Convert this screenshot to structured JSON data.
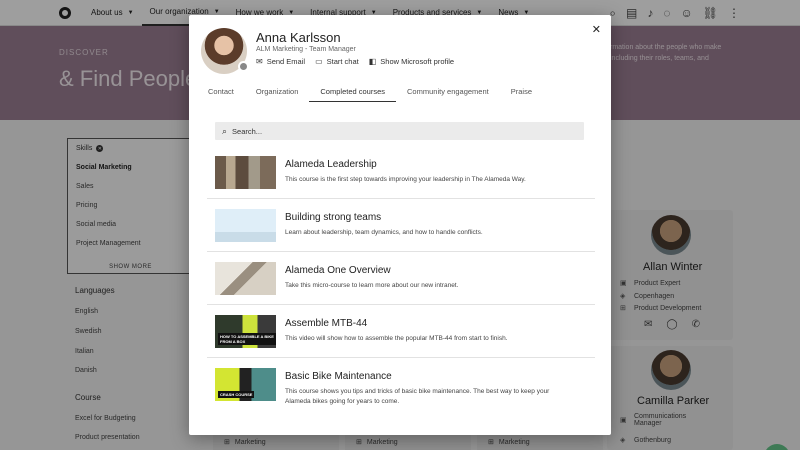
{
  "nav": {
    "items": [
      {
        "label": "About us",
        "active": false
      },
      {
        "label": "Our organization",
        "active": true
      },
      {
        "label": "How we work",
        "active": false
      },
      {
        "label": "Internal support",
        "active": false
      },
      {
        "label": "Products and services",
        "active": false
      },
      {
        "label": "News",
        "active": false
      }
    ],
    "icons": [
      "search-icon",
      "document-icon",
      "bell-icon",
      "chat-icon",
      "people-icon",
      "link-icon",
      "more-icon"
    ]
  },
  "hero": {
    "kicker": "DISCOVER",
    "title": "& Find People",
    "description": "rmation about the people who make including their roles, teams, and"
  },
  "filters": {
    "skills_label": "Skills",
    "skills": [
      "Social Marketing",
      "Sales",
      "Pricing",
      "Social media",
      "Project Management"
    ],
    "show_more": "SHOW MORE",
    "languages_label": "Languages",
    "languages": [
      "English",
      "Swedish",
      "Italian",
      "Danish"
    ],
    "course_label": "Course",
    "courses": [
      "Excel for Budgeting",
      "Product presentation"
    ]
  },
  "people": [
    {
      "name": "Allan Winter",
      "title": "Product Expert",
      "location": "Copenhagen",
      "department": "Product Development"
    },
    {
      "name": "Camilla Parker",
      "title": "Communications Manager",
      "location": "Gothenburg"
    }
  ],
  "bottom_tags": [
    "Marketing",
    "Marketing",
    "Marketing"
  ],
  "modal": {
    "name": "Anna Karlsson",
    "role": "ALM Marketing - Team Manager",
    "actions": [
      {
        "label": "Send Email",
        "icon": "mail-icon"
      },
      {
        "label": "Start chat",
        "icon": "chat-icon"
      },
      {
        "label": "Show Microsoft profile",
        "icon": "office-icon"
      }
    ],
    "tabs": [
      {
        "label": "Contact",
        "active": false
      },
      {
        "label": "Organization",
        "active": false
      },
      {
        "label": "Completed courses",
        "active": true
      },
      {
        "label": "Community engagement",
        "active": false
      },
      {
        "label": "Praise",
        "active": false
      }
    ],
    "search_placeholder": "Search...",
    "courses": [
      {
        "title": "Alameda Leadership",
        "description": "This course is the first step towards improving your leadership in The Alameda Way."
      },
      {
        "title": "Building strong teams",
        "description": "Learn about leadership, team dynamics, and how to handle conflicts."
      },
      {
        "title": "Alameda One Overview",
        "description": "Take this micro-course to learn more about our new intranet."
      },
      {
        "title": "Assemble MTB-44",
        "description": "This video will show how to assemble the popular MTB-44 from start to finish.",
        "thumb_text": "HOW TO ASSEMBLE A BIKE FROM A BOX"
      },
      {
        "title": "Basic Bike Maintenance",
        "description": "This course shows you tips and tricks of basic bike maintenance. The best way to keep your Alameda bikes going for years to come.",
        "thumb_text": "CRASH COURSE"
      }
    ]
  }
}
